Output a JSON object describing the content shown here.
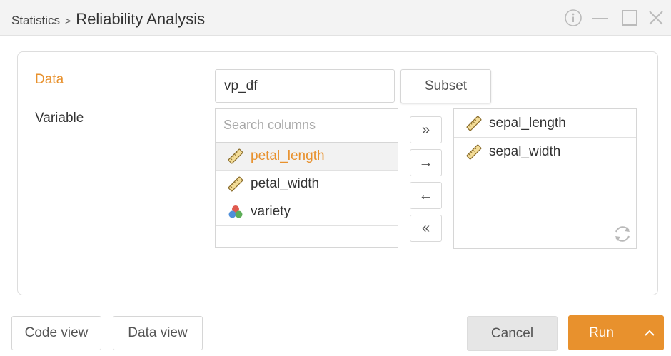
{
  "title": {
    "parent": "Statistics",
    "separator": ">",
    "current": "Reliability Analysis"
  },
  "form": {
    "data_label": "Data",
    "data_value": "vp_df",
    "subset_label": "Subset",
    "variable_label": "Variable",
    "search_placeholder": "Search columns"
  },
  "source_columns": [
    {
      "name": "petal_length",
      "icon": "ruler-icon",
      "selected": true
    },
    {
      "name": "petal_width",
      "icon": "ruler-icon",
      "selected": false
    },
    {
      "name": "variety",
      "icon": "category-circles-icon",
      "selected": false
    }
  ],
  "selected_columns": [
    {
      "name": "sepal_length",
      "icon": "ruler-icon"
    },
    {
      "name": "sepal_width",
      "icon": "ruler-icon"
    }
  ],
  "move_buttons": {
    "add_all": "»",
    "add": "→",
    "remove": "←",
    "remove_all": "«"
  },
  "footer": {
    "code_view": "Code view",
    "data_view": "Data view",
    "cancel": "Cancel",
    "run": "Run"
  },
  "colors": {
    "accent": "#e8912d",
    "titlebar_bg": "#f3f3f3",
    "cancel_bg": "#e6e6e6"
  }
}
